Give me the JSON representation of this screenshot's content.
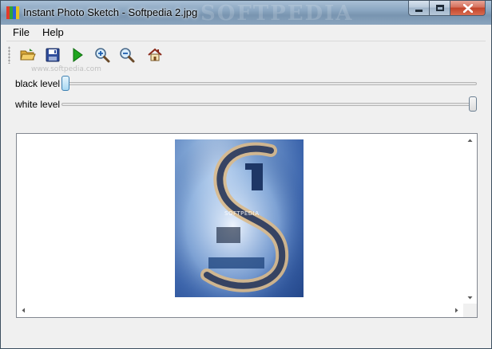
{
  "window": {
    "title": "Instant Photo Sketch - Softpedia 2.jpg",
    "titlebar_watermark": "SOFTPEDIA",
    "app_icon_colors": [
      "#e23a2a",
      "#2fa43a",
      "#2b62d9",
      "#e6c21f"
    ]
  },
  "menu": {
    "items": [
      {
        "label": "File"
      },
      {
        "label": "Help"
      }
    ]
  },
  "toolbar": {
    "watermark": "www.softpedia.com",
    "buttons": [
      {
        "name": "open-folder-icon"
      },
      {
        "name": "save-icon"
      },
      {
        "name": "run-icon"
      },
      {
        "name": "zoom-in-icon"
      },
      {
        "name": "zoom-out-icon"
      },
      {
        "name": "home-icon"
      }
    ]
  },
  "sliders": {
    "black_level": {
      "label": "black level",
      "value": 0.0
    },
    "white_level": {
      "label": "white level",
      "value": 1.0
    }
  },
  "image": {
    "brand_text": "SOFTPEDIA"
  },
  "colors": {
    "accent": "#3c7fb1",
    "close_button": "#c2432a",
    "window_bg": "#f0f0f0"
  }
}
